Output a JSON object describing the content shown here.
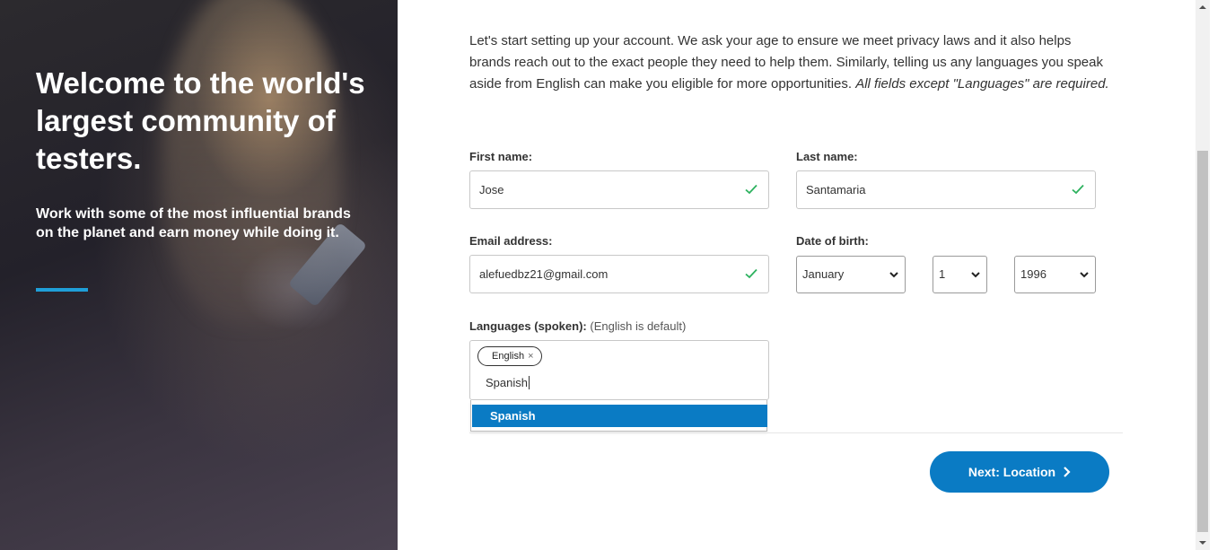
{
  "hero": {
    "headline": "Welcome to the world's largest community of testers.",
    "subheadline": "Work with some of the most influential brands on the planet and earn money while doing it."
  },
  "intro": {
    "text": "Let's start setting up your account. We ask your age to ensure we meet privacy laws and it also helps brands reach out to the exact people they need to help them. Similarly, telling us any languages you speak aside from English can make you eligible for more opportunities. ",
    "emphasis": "All fields except \"Languages\" are required."
  },
  "form": {
    "first_name": {
      "label": "First name:",
      "value": "Jose"
    },
    "last_name": {
      "label": "Last name:",
      "value": "Santamaria"
    },
    "email": {
      "label": "Email address:",
      "value": "alefuedbz21@gmail.com"
    },
    "dob": {
      "label": "Date of birth:",
      "month": "January",
      "day": "1",
      "year": "1996"
    },
    "languages": {
      "label": "Languages (spoken):",
      "hint": "(English is default)",
      "chips": [
        "English"
      ],
      "chip_remove": "×",
      "typed": "Spanish",
      "suggestions": [
        "Spanish"
      ]
    }
  },
  "actions": {
    "next_label": "Next: Location"
  },
  "colors": {
    "accent": "#0a7bc4",
    "hero_accent": "#1f9fd8",
    "valid": "#2db25f"
  },
  "icons": {
    "valid": "checkmark-icon",
    "next": "chevron-right-icon",
    "select": "chevron-down-icon"
  }
}
